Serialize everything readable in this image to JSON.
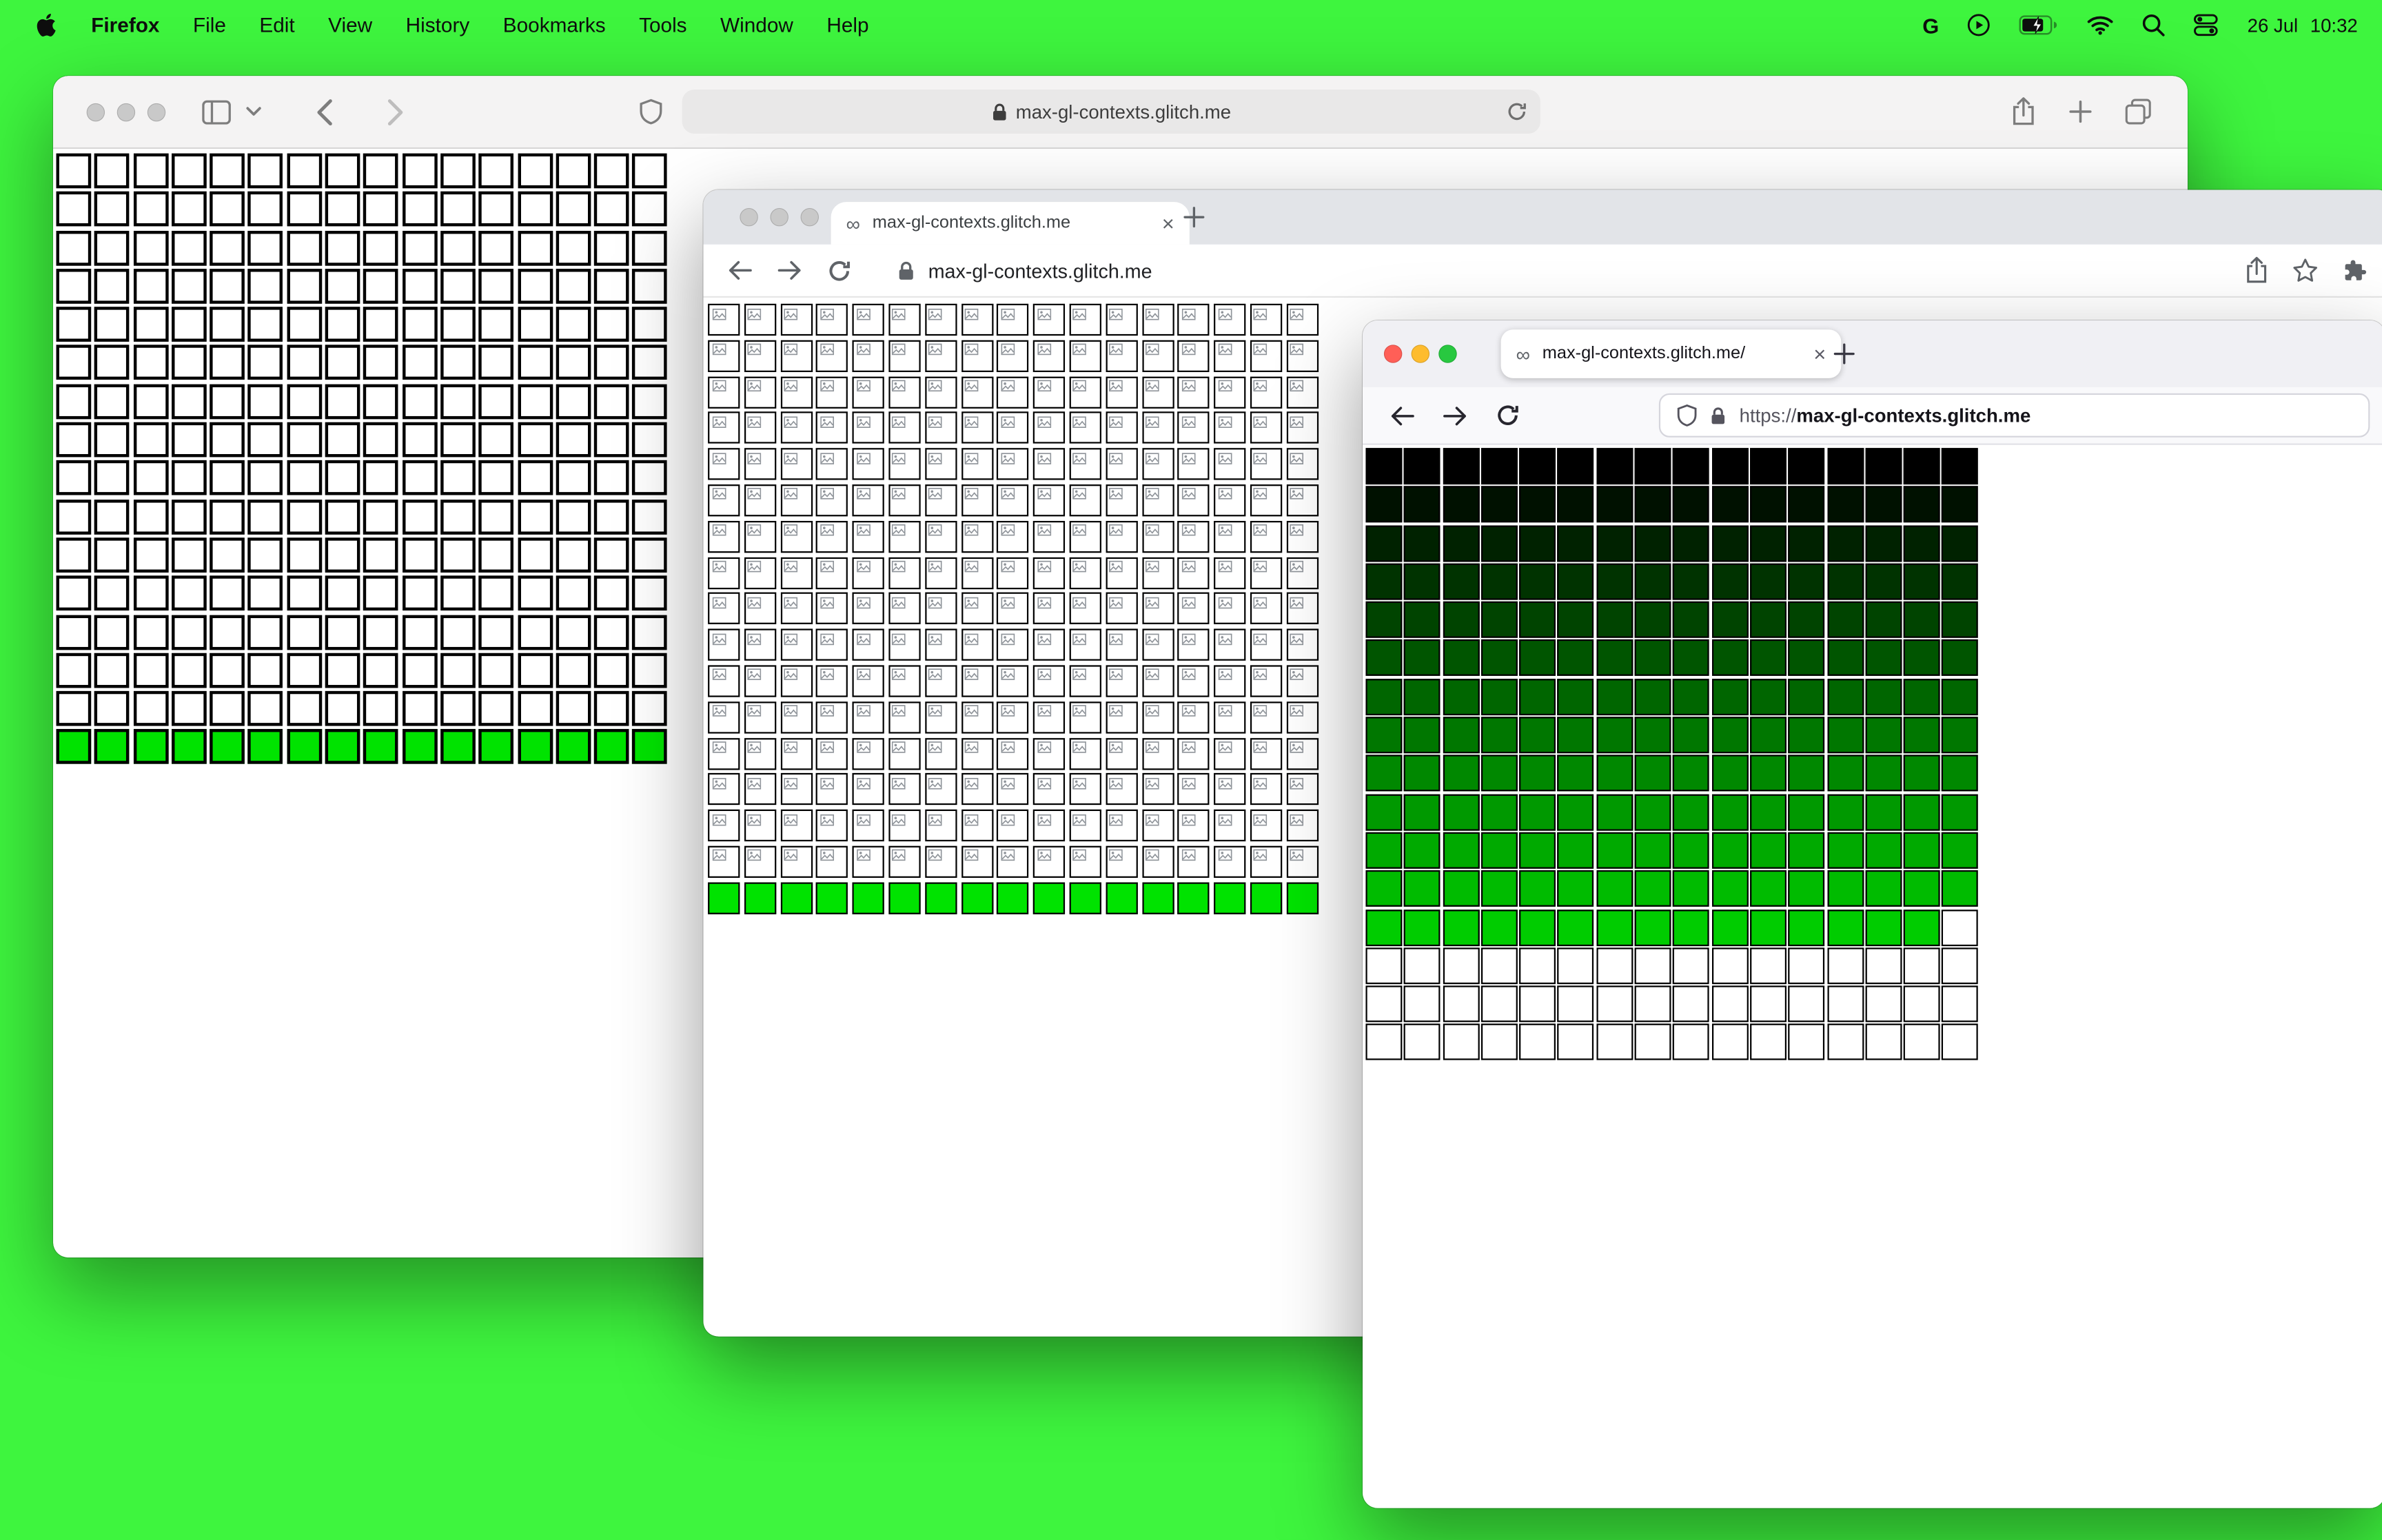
{
  "colors": {
    "desktop_green": "#3EF53E",
    "tl_inactive": "#c9c9c9",
    "tl_close": "#ff5f57",
    "tl_min": "#febc2e",
    "tl_zoom": "#28c840"
  },
  "menu_bar": {
    "app_name": "Firefox",
    "items": [
      "File",
      "Edit",
      "View",
      "History",
      "Bookmarks",
      "Tools",
      "Window",
      "Help"
    ],
    "status_icons": [
      "google-icon",
      "play-icon",
      "battery-charging-icon",
      "wifi-icon",
      "search-icon",
      "control-center-icon"
    ],
    "date": "26 Jul",
    "time": "10:32"
  },
  "safari_window": {
    "url": "max-gl-contexts.glitch.me",
    "grid": {
      "cols": 16,
      "rows": 16,
      "cell": 23,
      "gap": 2.3,
      "border_width": 2,
      "border_color": "#000000",
      "default_fill": "#ffffff",
      "last_row_fill": "#00e300"
    }
  },
  "chrome_window": {
    "tab_title": "max-gl-contexts.glitch.me",
    "url": "max-gl-contexts.glitch.me",
    "grid": {
      "cols": 17,
      "rows": 17,
      "cell": 21,
      "gap": 2.8,
      "border_width": 1.5,
      "border_color": "#000000",
      "default_fill": "#ffffff",
      "last_row_fill": "#00e300",
      "broken_icon": true
    }
  },
  "firefox_window": {
    "tab_title": "max-gl-contexts.glitch.me/",
    "url_scheme": "https://",
    "url_host": "max-gl-contexts.glitch.me",
    "grid": {
      "cols": 16,
      "rows": 16,
      "cell": 24,
      "gap": 1.3,
      "border_width": 1,
      "border_color": "#000000",
      "default_fill": "#ffffff",
      "gradient": {
        "rows": 13,
        "from": [
          0,
          0,
          0
        ],
        "to": [
          0,
          204,
          0
        ],
        "partial_last": true
      }
    }
  }
}
